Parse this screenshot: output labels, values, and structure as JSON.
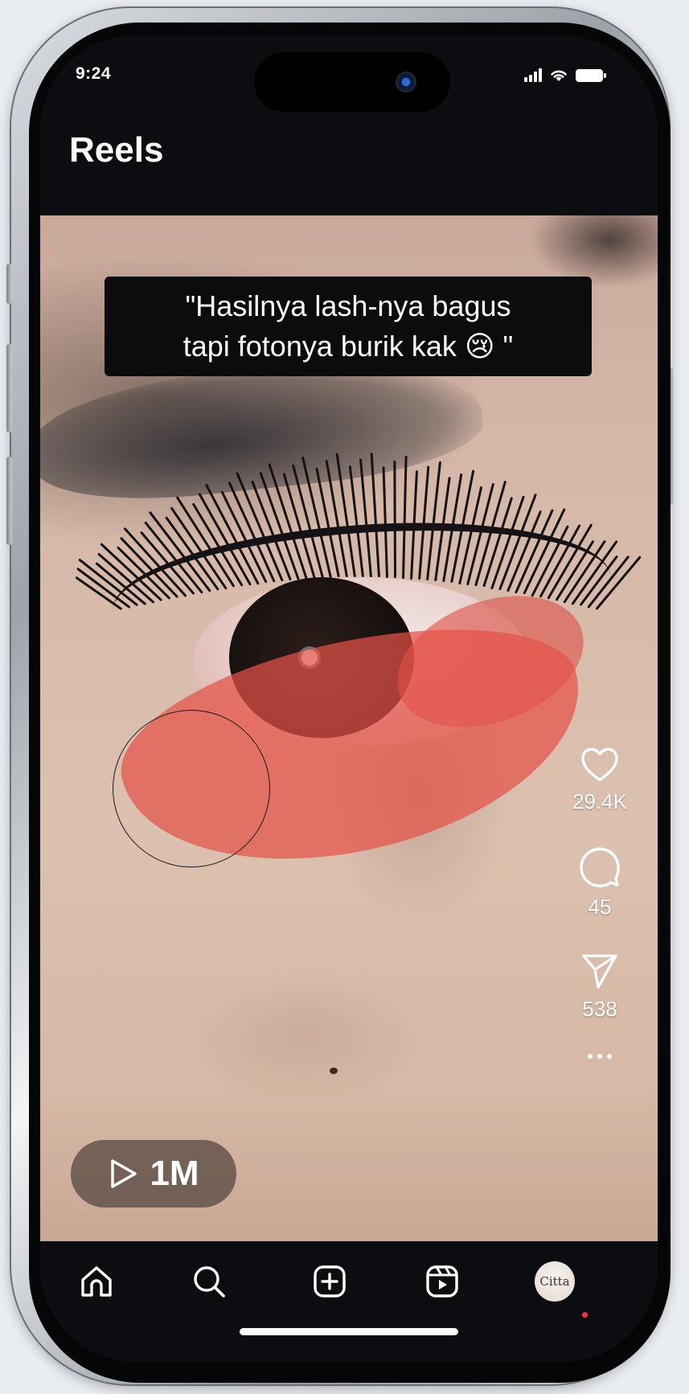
{
  "status_bar": {
    "time": "9:24"
  },
  "header": {
    "title": "Reels"
  },
  "reel": {
    "caption_line1": "\"Hasilnya lash-nya bagus",
    "caption_line2_text": "tapi fotonya burik kak ",
    "caption_emoji": "😢",
    "caption_line2_end": " \"",
    "plays": "1M"
  },
  "actions": {
    "likes": "29.4K",
    "comments": "45",
    "shares": "538"
  },
  "bottom_nav": {
    "profile_avatar_text": "Citta"
  },
  "icons": [
    "heart-icon",
    "comment-icon",
    "send-icon",
    "more-icon",
    "play-icon",
    "home-icon",
    "search-icon",
    "create-icon",
    "reels-icon"
  ],
  "colors": {
    "background": "#0b0d11",
    "redness_overlay": "#e45248",
    "notification_dot": "#ff2d3d"
  }
}
